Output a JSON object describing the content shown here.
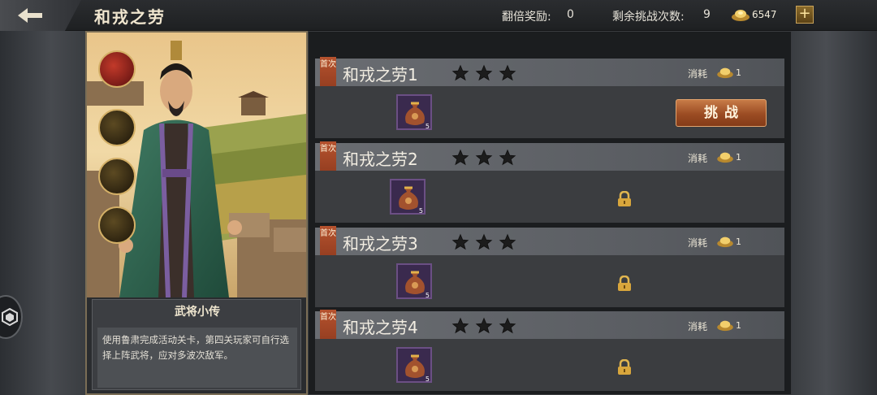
{
  "header": {
    "title": "和戎之劳",
    "double_reward_label": "翻倍奖励:",
    "double_reward_value": "0",
    "remaining_label": "剩余挑战次数:",
    "remaining_value": "9",
    "coins": "6547"
  },
  "hero": {
    "bio_title": "武将小传",
    "bio_text": "使用鲁肃完成活动关卡，第四关玩家可自行选择上阵武将，应对多波次敌军。"
  },
  "stages": [
    {
      "tag": "首次",
      "name": "和戎之劳1",
      "stars": 3,
      "cost_label": "消耗",
      "cost": "1",
      "reward_qty": "5",
      "state": "unlocked",
      "button": "挑战"
    },
    {
      "tag": "首次",
      "name": "和戎之劳2",
      "stars": 3,
      "cost_label": "消耗",
      "cost": "1",
      "reward_qty": "5",
      "state": "locked"
    },
    {
      "tag": "首次",
      "name": "和戎之劳3",
      "stars": 3,
      "cost_label": "消耗",
      "cost": "1",
      "reward_qty": "5",
      "state": "locked"
    },
    {
      "tag": "首次",
      "name": "和戎之劳4",
      "stars": 3,
      "cost_label": "消耗",
      "cost": "1",
      "reward_qty": "5",
      "state": "locked"
    }
  ],
  "icons": {
    "back": "back-arrow-icon",
    "currency": "gold-ingot-icon",
    "add": "plus-icon",
    "reward": "reward-bag-icon",
    "lock": "lock-icon",
    "star": "star-icon"
  },
  "colors": {
    "accent": "#b5522e",
    "button": "#9b4c23",
    "gold": "#d4b067"
  }
}
